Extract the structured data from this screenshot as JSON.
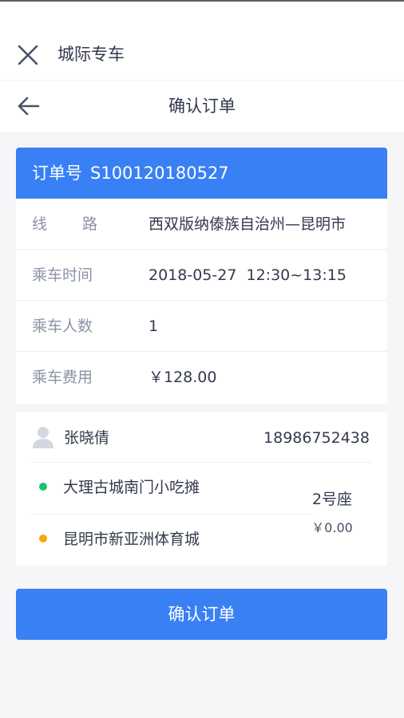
{
  "app_bar": {
    "title": "城际专车",
    "close_icon": "close-icon"
  },
  "nav_bar": {
    "title": "确认订单",
    "back_icon": "back-arrow-icon"
  },
  "order": {
    "number_label": "订单号",
    "number": "S100120180527",
    "route_label_1": "线",
    "route_label_2": "路",
    "route_value": "西双版纳傣族自治州—昆明市",
    "time_label": "乘车时间",
    "time_value": "2018-05-27  12:30~13:15",
    "passengers_label": "乘车人数",
    "passengers_value": "1",
    "fee_label": "乘车费用",
    "fee_value": "￥128.00"
  },
  "passenger": {
    "name": "张晓倩",
    "phone": "18986752438",
    "start_stop": "大理古城南门小吃摊",
    "end_stop": "昆明市新亚洲体育城",
    "seat": "2号座",
    "price": "￥0.00",
    "start_dot_color": "#1fc26b",
    "end_dot_color": "#f2a712"
  },
  "actions": {
    "confirm_label": "确认订单"
  },
  "colors": {
    "primary": "#3a80f5",
    "background": "#f6f6f8",
    "label_gray": "#8a93a6"
  }
}
